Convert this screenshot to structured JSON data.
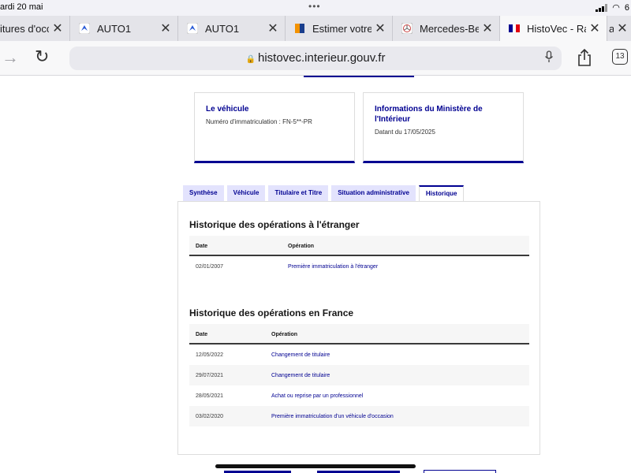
{
  "status": {
    "time": "ardi 20 mai",
    "dots": "•••",
    "battery": "6"
  },
  "tabs": [
    {
      "title": "itures d'occa",
      "favicon": "none",
      "active": false
    },
    {
      "title": "AUTO1",
      "favicon": "auto1-logo-icon",
      "active": false
    },
    {
      "title": "AUTO1",
      "favicon": "auto1-logo-icon",
      "active": false
    },
    {
      "title": "Estimer votre a",
      "favicon": "orange-blue-flag-icon",
      "active": false
    },
    {
      "title": "Mercedes-Benz",
      "favicon": "mercedes-logo-icon",
      "active": false
    },
    {
      "title": "HistoVec - Rapp",
      "favicon": "french-flag-icon",
      "active": true
    },
    {
      "title": "a",
      "favicon": "none",
      "active": false
    }
  ],
  "toolbar": {
    "url": "histovec.interieur.gouv.fr",
    "tab_count": "13"
  },
  "cards": [
    {
      "title": "Le véhicule",
      "text": "Numéro d'immatriculation : FN-5**-PR"
    },
    {
      "title": "Informations du Ministère de l'Intérieur",
      "text": "Datant du 17/05/2025"
    }
  ],
  "page_tabs": [
    "Synthèse",
    "Véhicule",
    "Titulaire et Titre",
    "Situation administrative",
    "Historique"
  ],
  "active_page_tab": "Historique",
  "foreign": {
    "title": "Historique des opérations à l'étranger",
    "columns": [
      "Date",
      "Opération"
    ],
    "rows": [
      {
        "date": "02/01/2007",
        "operation": "Première immatriculation à l'étranger"
      }
    ]
  },
  "france": {
    "title": "Historique des opérations en France",
    "columns": [
      "Date",
      "Opération"
    ],
    "rows": [
      {
        "date": "12/05/2022",
        "operation": "Changement de titulaire"
      },
      {
        "date": "29/07/2021",
        "operation": "Changement de titulaire"
      },
      {
        "date": "28/05/2021",
        "operation": "Achat ou reprise par un professionnel"
      },
      {
        "date": "03/02/2020",
        "operation": "Première immatriculation d'un véhicule d'occasion"
      }
    ]
  },
  "colors": {
    "accent": "#000091",
    "tab_bg": "#e3e3fd",
    "row_alt": "#f6f6f6"
  }
}
